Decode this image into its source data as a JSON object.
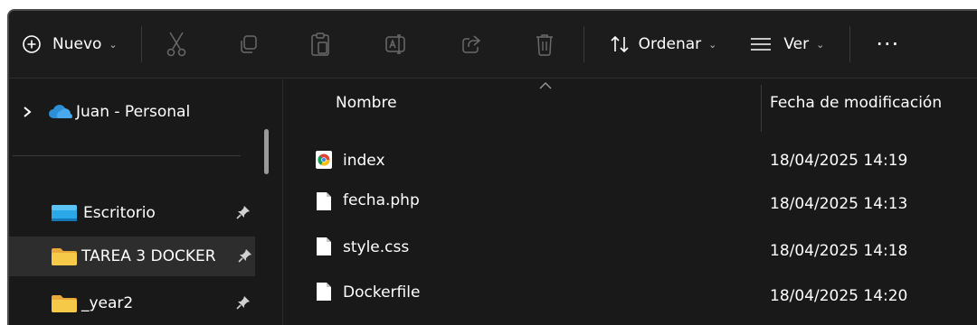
{
  "toolbar": {
    "new_label": "Nuevo",
    "sort_label": "Ordenar",
    "view_label": "Ver",
    "more_label": "···"
  },
  "sidebar": {
    "items": [
      {
        "label": "Juan - Personal",
        "icon": "onedrive-cloud-icon"
      },
      {
        "label": "Escritorio",
        "icon": "desktop-folder-icon",
        "pinned": true
      },
      {
        "label": "TAREA 3 DOCKER",
        "icon": "folder-icon",
        "pinned": true,
        "selected": true
      },
      {
        "label": "_year2",
        "icon": "folder-icon",
        "pinned": true
      }
    ]
  },
  "list": {
    "columns": {
      "name": "Nombre",
      "date": "Fecha de modificación"
    },
    "files": [
      {
        "name": "index",
        "date": "18/04/2025 14:19",
        "icon": "chrome-html-icon"
      },
      {
        "name": "fecha.php",
        "date": "18/04/2025 14:13",
        "icon": "file-icon"
      },
      {
        "name": "style.css",
        "date": "18/04/2025 14:18",
        "icon": "file-icon"
      },
      {
        "name": "Dockerfile",
        "date": "18/04/2025 14:20",
        "icon": "file-icon"
      }
    ]
  },
  "colors": {
    "background": "#191919",
    "selected_row": "#2d2d2d",
    "folder_yellow": "#f7c948",
    "onedrive_blue": "#2d8fd6"
  }
}
